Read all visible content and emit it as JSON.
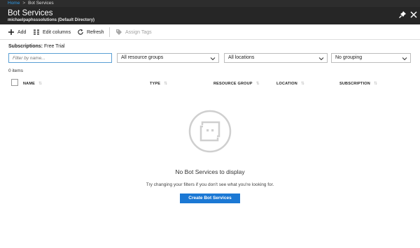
{
  "breadcrumb": {
    "home": "Home",
    "separator": ">",
    "current": "Bot Services"
  },
  "blade": {
    "title": "Bot Services",
    "subtitle": "michaelpaphsssolutions (Default Directory)"
  },
  "toolbar": {
    "add": "Add",
    "edit_columns": "Edit columns",
    "refresh": "Refresh",
    "assign_tags": "Assign Tags"
  },
  "subscription": {
    "label": "Subscriptions:",
    "value": "Free Trial"
  },
  "filters": {
    "search_placeholder": "Filter by name...",
    "resource_groups": "All resource groups",
    "locations": "All locations",
    "grouping": "No grouping"
  },
  "item_count": "0 items",
  "columns": [
    "NAME",
    "TYPE",
    "RESOURCE GROUP",
    "LOCATION",
    "SUBSCRIPTION"
  ],
  "empty_state": {
    "title": "No Bot Services to display",
    "hint": "Try changing your filters if you don't see what you're looking for.",
    "button": "Create Bot Services"
  },
  "colors": {
    "accent": "#1b78d4",
    "header_bg": "#262626",
    "link": "#2e9ae8"
  }
}
